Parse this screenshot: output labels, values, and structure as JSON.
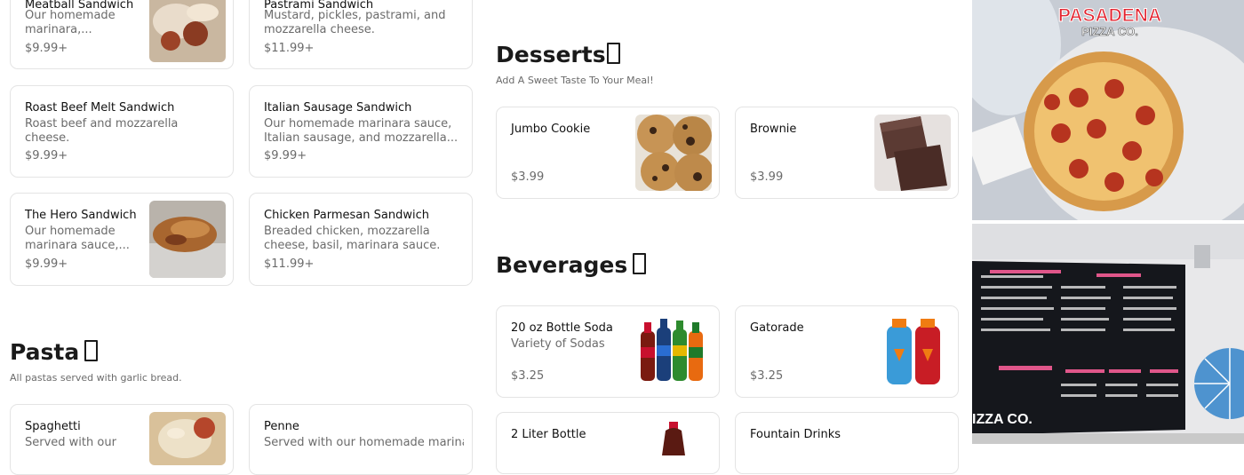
{
  "sandwiches": {
    "meatball": {
      "name": "Meatball Sandwich",
      "desc": "Our homemade marinara,...",
      "price": "$9.99+"
    },
    "pastrami": {
      "name": "Pastrami Sandwich",
      "desc": "Mustard, pickles, pastrami, and mozzarella cheese.",
      "price": "$11.99+"
    },
    "roast_beef": {
      "name": "Roast Beef Melt Sandwich",
      "desc": "Roast beef and mozzarella cheese.",
      "price": "$9.99+"
    },
    "italian_sausage": {
      "name": "Italian Sausage Sandwich",
      "desc": "Our homemade marinara sauce, Italian sausage, and mozzarella...",
      "price": "$9.99+"
    },
    "hero": {
      "name": "The Hero Sandwich",
      "desc": "Our homemade marinara sauce,...",
      "price": "$9.99+"
    },
    "chicken_parm": {
      "name": "Chicken Parmesan Sandwich",
      "desc": "Breaded chicken, mozzarella cheese, basil, marinara sauce.",
      "price": "$11.99+"
    }
  },
  "pasta": {
    "title": "Pasta",
    "subtitle": "All pastas served with garlic bread.",
    "spaghetti": {
      "name": "Spaghetti",
      "desc": "Served with our"
    },
    "penne": {
      "name": "Penne",
      "desc": "Served with our homemade marinara"
    }
  },
  "desserts": {
    "title": "Desserts",
    "subtitle": "Add A Sweet Taste To Your Meal!",
    "cookie": {
      "name": "Jumbo Cookie",
      "price": "$3.99"
    },
    "brownie": {
      "name": "Brownie",
      "price": "$3.99"
    }
  },
  "beverages": {
    "title": "Beverages",
    "soda": {
      "name": "20 oz Bottle Soda",
      "desc": "Variety of Sodas",
      "price": "$3.25"
    },
    "gatorade": {
      "name": "Gatorade",
      "price": "$3.25"
    },
    "two_liter": {
      "name": "2 Liter Bottle"
    },
    "fountain": {
      "name": "Fountain Drinks"
    }
  },
  "photos": {
    "logo_line1": "PASADENA",
    "logo_line2": "PIZZA CO.",
    "menu_board_text": "IZZA CO."
  },
  "colors": {
    "card_border": "#e4e4e4",
    "muted_text": "#6b6b6b",
    "logo_red": "#e3232f"
  }
}
